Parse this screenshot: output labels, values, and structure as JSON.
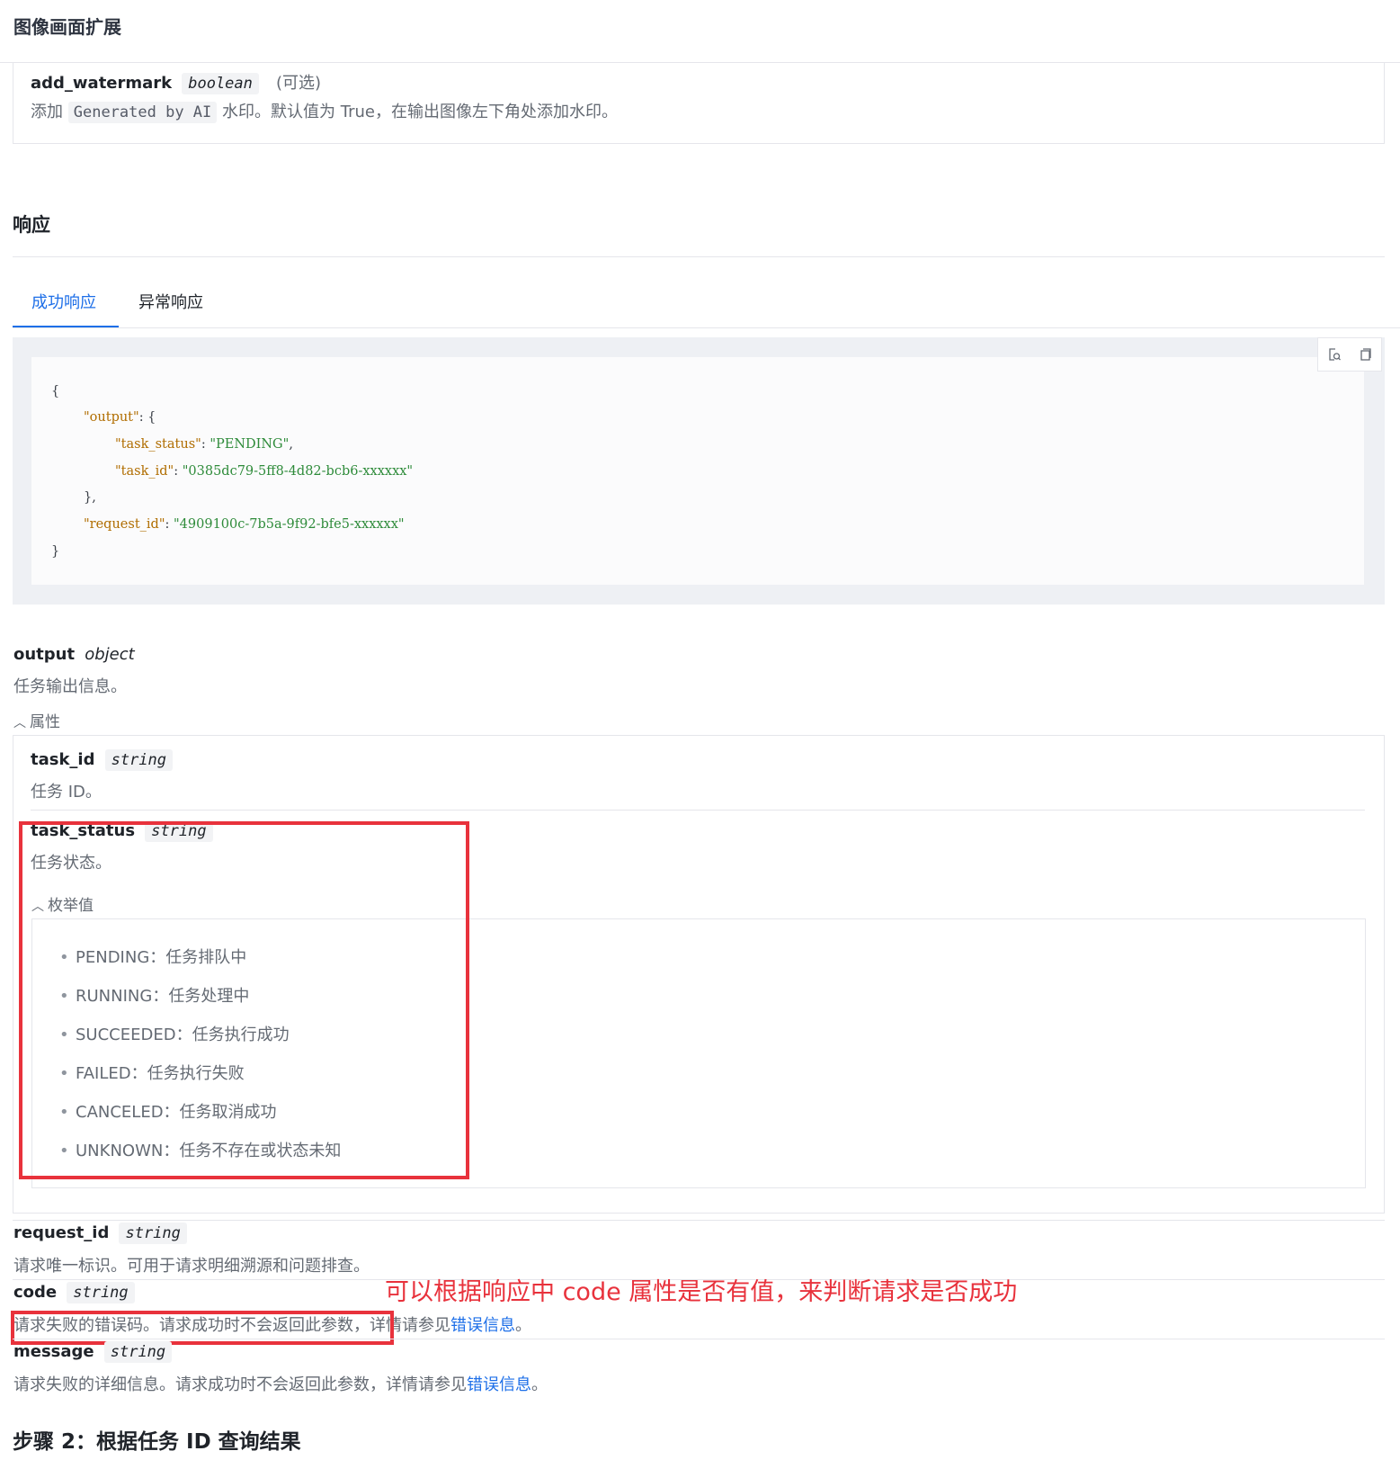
{
  "header": {
    "title": "图像画面扩展"
  },
  "param": {
    "name": "add_watermark",
    "type": "boolean",
    "optional": "(可选)",
    "desc_prefix": "添加",
    "desc_code": "Generated by AI",
    "desc_suffix": "水印。默认值为 True，在输出图像左下角处添加水印。"
  },
  "response": {
    "title": "响应",
    "tabs": [
      {
        "label": "成功响应",
        "active": true
      },
      {
        "label": "异常响应",
        "active": false
      }
    ],
    "code": {
      "open": "{",
      "output_key": "\"output\"",
      "output_open": ": {",
      "task_status_key": "\"task_status\"",
      "task_status_val": "\"PENDING\"",
      "task_id_key": "\"task_id\"",
      "task_id_val": "\"0385dc79-5ff8-4d82-bcb6-xxxxxx\"",
      "output_close": "},",
      "request_id_key": "\"request_id\"",
      "request_id_val": "\"4909100c-7b5a-9f92-bfe5-xxxxxx\"",
      "close": "}"
    },
    "code_buttons": [
      "search-code-icon",
      "copy-icon"
    ]
  },
  "output_field": {
    "name": "output",
    "type": "object",
    "desc": "任务输出信息。",
    "toggle": "属性"
  },
  "task_id_field": {
    "name": "task_id",
    "type": "string",
    "desc": "任务 ID。"
  },
  "task_status_field": {
    "name": "task_status",
    "type": "string",
    "desc": "任务状态。",
    "toggle": "枚举值",
    "enums": [
      "PENDING：任务排队中",
      "RUNNING：任务处理中",
      "SUCCEEDED：任务执行成功",
      "FAILED：任务执行失败",
      "CANCELED：任务取消成功",
      "UNKNOWN：任务不存在或状态未知"
    ]
  },
  "request_id_field": {
    "name": "request_id",
    "type": "string",
    "desc": "请求唯一标识。可用于请求明细溯源和问题排查。"
  },
  "code_field": {
    "name": "code",
    "type": "string",
    "desc": "请求失败的错误码。请求成功时不会返回此参数，",
    "desc_tail": "详情请参见",
    "link": "错误信息",
    "end": "。"
  },
  "message_field": {
    "name": "message",
    "type": "string",
    "desc": "请求失败的详细信息。请求成功时不会返回此参数，详情请参见",
    "link": "错误信息",
    "end": "。"
  },
  "annotation": {
    "note": "可以根据响应中 code 属性是否有值，来判断请求是否成功",
    "color": "#e8323c"
  },
  "step": {
    "title": "步骤 2：根据任务 ID 查询结果"
  },
  "colors": {
    "accent": "#1e6fe8",
    "annotation": "#e8323c",
    "json_key": "#b06d00",
    "json_string": "#2e8b3a"
  }
}
